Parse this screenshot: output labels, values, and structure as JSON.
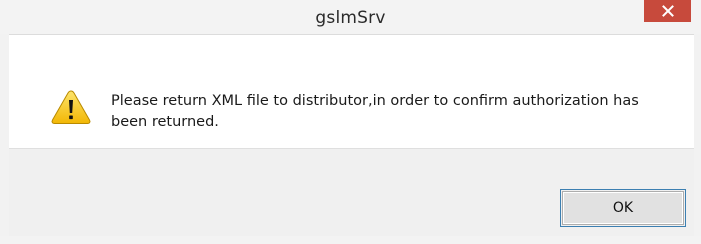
{
  "window": {
    "title": "gslmSrv",
    "close_icon": "close-icon",
    "close_color": "#c74a3c"
  },
  "dialog": {
    "icon": "warning-icon",
    "message": "Please return XML file to distributor,in order to confirm authorization has been returned."
  },
  "buttons": {
    "ok_label": "OK"
  }
}
